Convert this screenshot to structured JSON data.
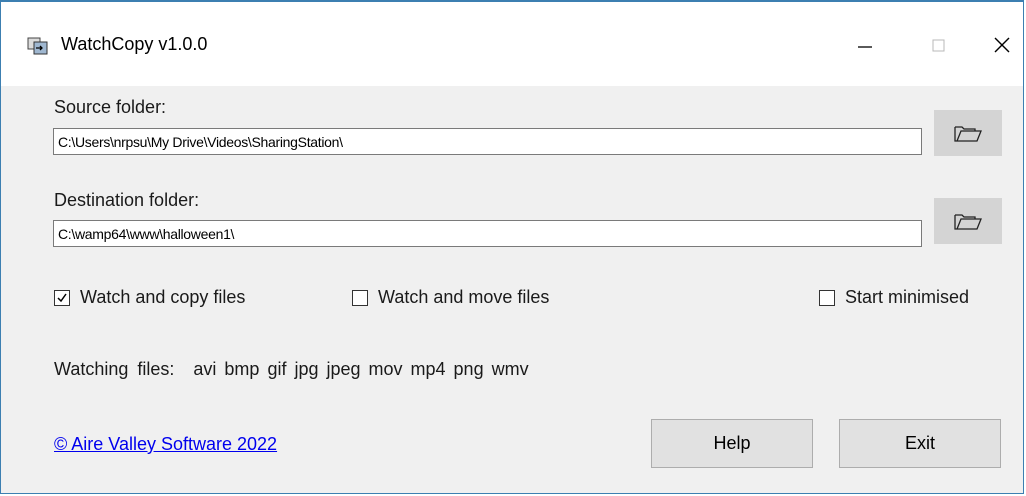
{
  "window": {
    "title": "WatchCopy v1.0.0",
    "icon": "app-icon",
    "controls": {
      "minimize_icon": "minimize-icon",
      "maximize_icon": "maximize-icon",
      "close_icon": "close-icon"
    }
  },
  "source": {
    "label": "Source folder:",
    "value": "C:\\Users\\nrpsu\\My Drive\\Videos\\SharingStation\\",
    "browse_icon": "folder-open-icon"
  },
  "destination": {
    "label": "Destination folder:",
    "value": "C:\\wamp64\\www\\halloween1\\",
    "browse_icon": "folder-open-icon"
  },
  "options": {
    "watch_copy": {
      "label": "Watch and copy files",
      "checked": true
    },
    "watch_move": {
      "label": "Watch and move files",
      "checked": false
    },
    "start_minimised": {
      "label": "Start minimised",
      "checked": false
    }
  },
  "watching": {
    "label": "Watching files:",
    "extensions": [
      "avi",
      "bmp",
      "gif",
      "jpg",
      "jpeg",
      "mov",
      "mp4",
      "png",
      "wmv"
    ]
  },
  "footer": {
    "copyright": "© Aire Valley Software 2022",
    "help_label": "Help",
    "exit_label": "Exit"
  },
  "colors": {
    "window_bg": "#f0f0f0",
    "accent_border": "#3c7fb1",
    "link": "#0000ee",
    "button_bg": "#e1e1e1",
    "browse_bg": "#d4d4d4"
  }
}
